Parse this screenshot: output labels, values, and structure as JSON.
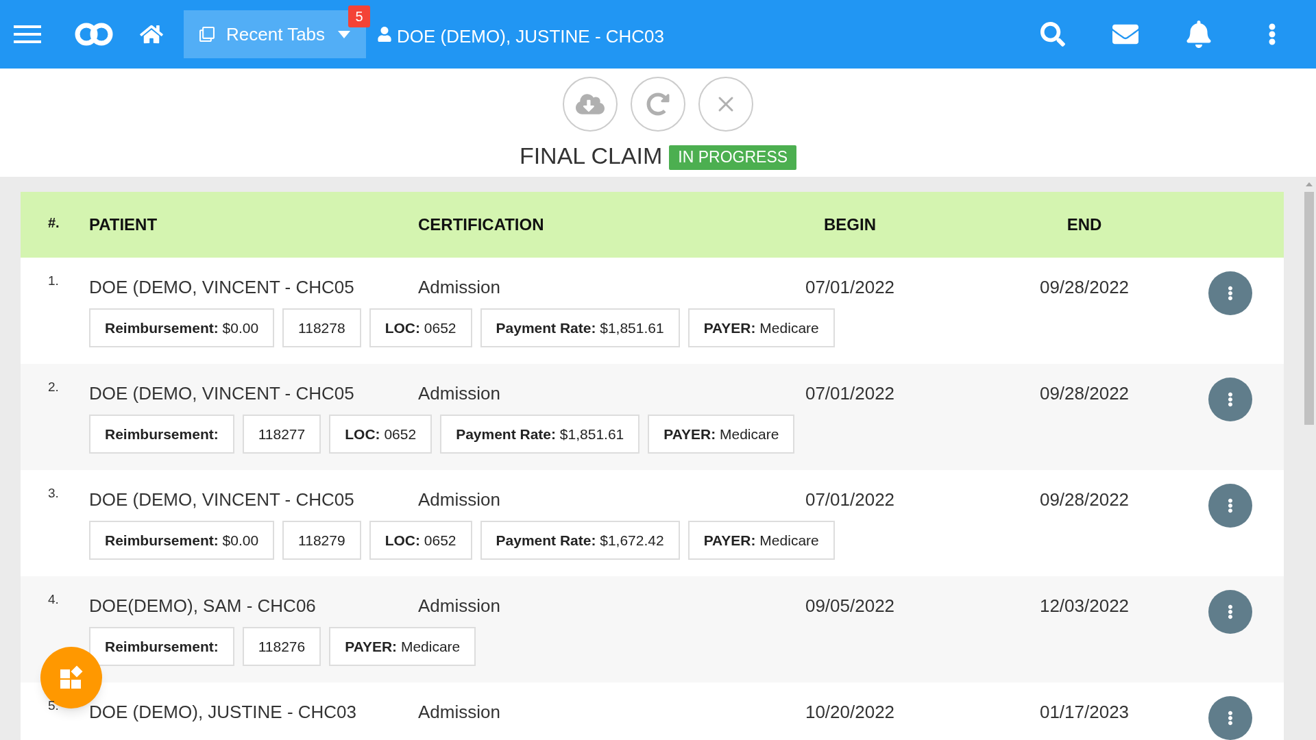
{
  "top_bar": {
    "recent_tabs": {
      "label": "Recent Tabs",
      "badge": "5"
    },
    "patient": "DOE (DEMO), JUSTINE - CHC03"
  },
  "claim": {
    "title": "FINAL CLAIM",
    "status": "IN PROGRESS"
  },
  "table": {
    "columns": [
      "#.",
      "PATIENT",
      "CERTIFICATION",
      "BEGIN",
      "END"
    ],
    "rows": [
      {
        "number": "1.",
        "patient": "DOE (DEMO, VINCENT - CHC05",
        "certification": "Admission",
        "begin": "07/01/2022",
        "end": "09/28/2022",
        "tags": [
          {
            "kind": "labeled",
            "label": "Reimbursement:",
            "value": "$0.00"
          },
          {
            "kind": "plain",
            "value": "118278"
          },
          {
            "kind": "labeled",
            "label": "LOC:",
            "value": "0652"
          },
          {
            "kind": "labeled",
            "label": "Payment Rate:",
            "value": "$1,851.61"
          },
          {
            "kind": "labeled",
            "label": "PAYER:",
            "value": "Medicare"
          }
        ]
      },
      {
        "number": "2.",
        "patient": "DOE (DEMO, VINCENT - CHC05",
        "certification": "Admission",
        "begin": "07/01/2022",
        "end": "09/28/2022",
        "tags": [
          {
            "kind": "labeled",
            "label": "Reimbursement:"
          },
          {
            "kind": "plain",
            "value": "118277"
          },
          {
            "kind": "labeled",
            "label": "LOC:",
            "value": "0652"
          },
          {
            "kind": "labeled",
            "label": "Payment Rate:",
            "value": "$1,851.61"
          },
          {
            "kind": "labeled",
            "label": "PAYER:",
            "value": "Medicare"
          }
        ]
      },
      {
        "number": "3.",
        "patient": "DOE (DEMO, VINCENT - CHC05",
        "certification": "Admission",
        "begin": "07/01/2022",
        "end": "09/28/2022",
        "tags": [
          {
            "kind": "labeled",
            "label": "Reimbursement:",
            "value": "$0.00"
          },
          {
            "kind": "plain",
            "value": "118279"
          },
          {
            "kind": "labeled",
            "label": "LOC:",
            "value": "0652"
          },
          {
            "kind": "labeled",
            "label": "Payment Rate:",
            "value": "$1,672.42"
          },
          {
            "kind": "labeled",
            "label": "PAYER:",
            "value": "Medicare"
          }
        ]
      },
      {
        "number": "4.",
        "patient": "DOE(DEMO), SAM - CHC06",
        "certification": "Admission",
        "begin": "09/05/2022",
        "end": "12/03/2022",
        "tags": [
          {
            "kind": "labeled",
            "label": "Reimbursement:"
          },
          {
            "kind": "plain",
            "value": "118276"
          },
          {
            "kind": "labeled",
            "label": "PAYER:",
            "value": "Medicare"
          }
        ]
      },
      {
        "number": "5.",
        "patient": "DOE (DEMO), JUSTINE - CHC03",
        "certification": "Admission",
        "begin": "10/20/2022",
        "end": "01/17/2023"
      }
    ]
  }
}
